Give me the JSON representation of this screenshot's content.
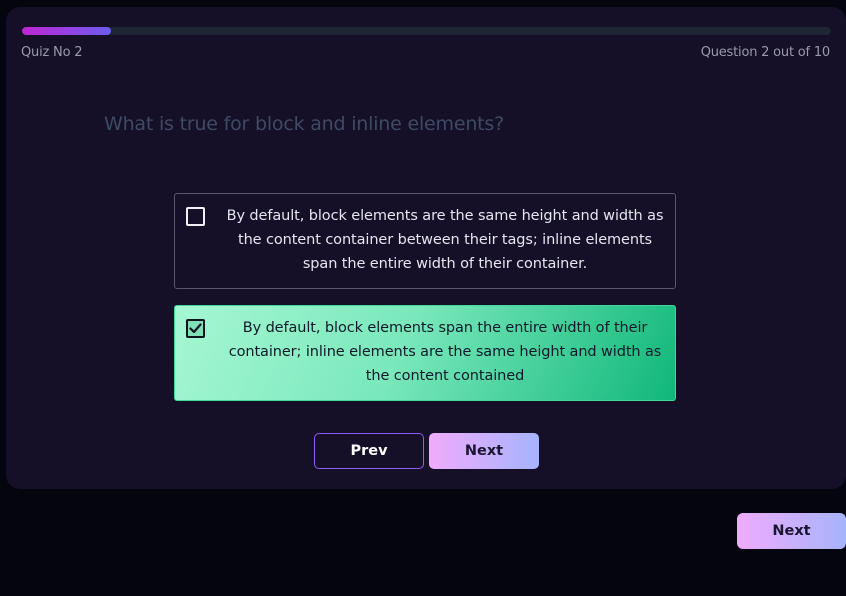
{
  "progress": {
    "current": 2,
    "total": 10
  },
  "header": {
    "quiz_label": "Quiz No 2",
    "question_counter": "Question 2 out of 10"
  },
  "question": {
    "text": "What is true for block and inline elements?"
  },
  "options": [
    {
      "text": "By default, block elements are the same height and width as the content container between their tags; inline elements span the entire width of their container.",
      "checked": false
    },
    {
      "text": "By default, block elements span the entire width of their container; inline elements are the same height and width as the content contained",
      "checked": true
    }
  ],
  "buttons": {
    "prev": "Prev",
    "next": "Next",
    "outer_next": "Next"
  },
  "colors": {
    "card_bg": "#150f27",
    "page_bg": "#05050f",
    "progress_start": "#c026d3",
    "progress_end": "#6d5cf0",
    "selected_option": "#10b77a",
    "button_gradient_start": "#f0abfc",
    "button_gradient_end": "#a5b4fc"
  },
  "icons": {
    "checked": "check-icon"
  }
}
